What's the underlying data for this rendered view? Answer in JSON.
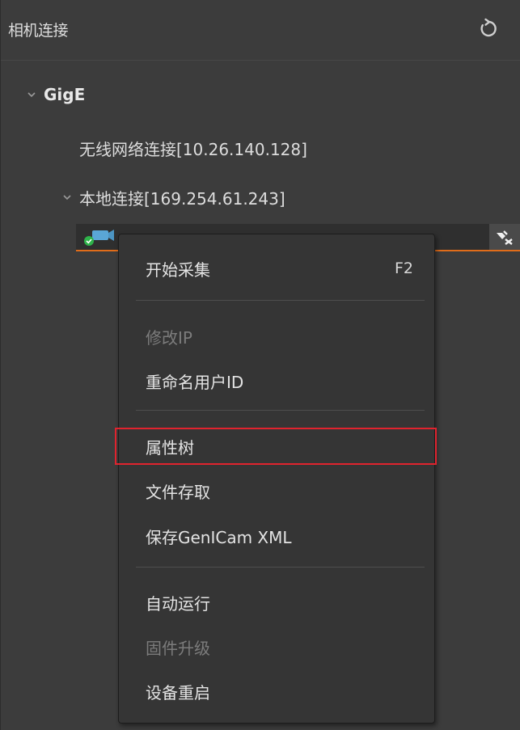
{
  "header": {
    "title": "相机连接",
    "refresh_icon": "refresh-icon"
  },
  "tree": {
    "group": {
      "label": "GigE",
      "expanded": true
    },
    "connections": [
      {
        "label": "无线网络连接[10.26.140.128]",
        "expanded": false
      },
      {
        "label": "本地连接[169.254.61.243]",
        "expanded": true
      }
    ],
    "device": {
      "status": "connected",
      "icons": [
        "camera-icon",
        "disconnect-icon"
      ]
    }
  },
  "context_menu": {
    "items": [
      {
        "label": "开始采集",
        "shortcut": "F2",
        "enabled": true
      },
      {
        "label": "修改IP",
        "enabled": false
      },
      {
        "label": "重命名用户ID",
        "enabled": true
      },
      {
        "label": "属性树",
        "enabled": true,
        "highlighted": true
      },
      {
        "label": "文件存取",
        "enabled": true
      },
      {
        "label": "保存GenICam XML",
        "enabled": true
      },
      {
        "label": "自动运行",
        "enabled": true
      },
      {
        "label": "固件升级",
        "enabled": false
      },
      {
        "label": "设备重启",
        "enabled": true
      }
    ]
  },
  "colors": {
    "panel_bg": "#3c3c3c",
    "menu_bg": "#353535",
    "accent_orange": "#e06c1a",
    "highlight_red": "#e0232e",
    "status_green": "#2fb34a",
    "camera_blue": "#5aa6d6"
  }
}
